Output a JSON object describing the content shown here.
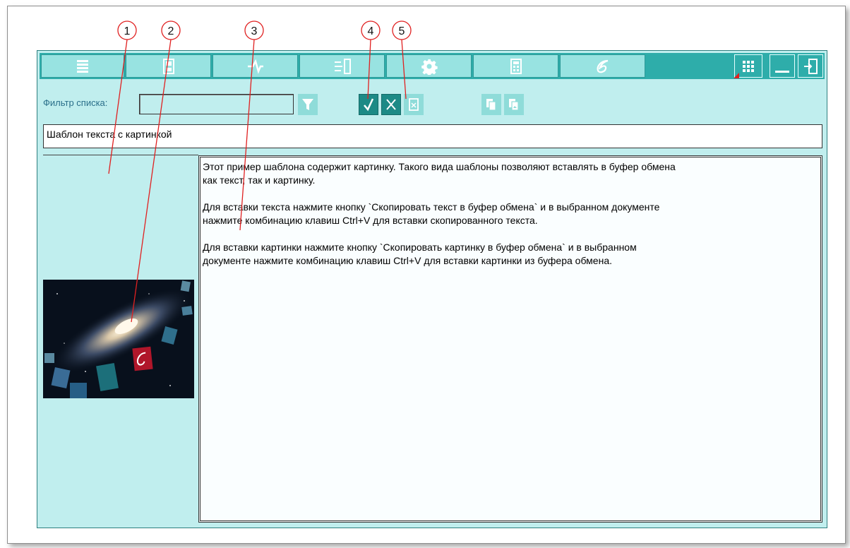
{
  "toolbar": {
    "tabs": [
      {
        "icon": "list-icon"
      },
      {
        "icon": "page-icon"
      },
      {
        "icon": "fork-arrow-icon"
      },
      {
        "icon": "transfer-icon"
      },
      {
        "icon": "gear-icon"
      },
      {
        "icon": "calculator-icon"
      },
      {
        "icon": "logo-icon"
      }
    ],
    "right_buttons": [
      {
        "icon": "grid-icon"
      },
      {
        "icon": "minimize-icon"
      },
      {
        "icon": "exit-icon"
      }
    ]
  },
  "filter": {
    "label": "Фильтр списка:",
    "value": ""
  },
  "template_title": "Шаблон текста с картинкой",
  "template_text": {
    "paragraphs": [
      "Этот пример шаблона содержит картинку. Такого вида шаблоны позволяют вставлять в буфер обмена\nкак текст, так и картинку.",
      "Для вставки текста нажмите кнопку `Скопировать текст в буфер обмена` и в выбранном документе\nнажмите комбинацию клавиш Ctrl+V для вставки скопированного текста.",
      "Для вставки картинки нажмите кнопку `Скопировать картинку в буфер обмена` и в выбранном\nдокументе нажмите комбинацию клавиш Ctrl+V для вставки картинки из буфера обмена."
    ]
  },
  "callouts": [
    "1",
    "2",
    "3",
    "4",
    "5"
  ],
  "colors": {
    "panel_bg": "#c0eeee",
    "toolbar_bg": "#2eadaa",
    "tab_bg": "#98e3e1",
    "button_dark": "#1d8a86",
    "callout_line": "#e02020"
  }
}
